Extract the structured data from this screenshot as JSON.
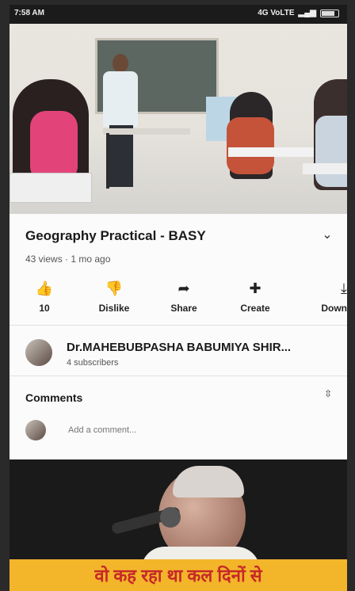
{
  "status_bar": {
    "time": "7:58 AM",
    "network": "4G VoLTE"
  },
  "video": {
    "title": "Geography Practical - BASY",
    "meta": "43 views · 1 mo ago",
    "actions": [
      {
        "icon": "thumbs-up-icon",
        "label": "10"
      },
      {
        "icon": "thumbs-down-icon",
        "label": "Dislike"
      },
      {
        "icon": "share-icon",
        "label": "Share"
      },
      {
        "icon": "create-icon",
        "label": "Create"
      },
      {
        "icon": "download-icon",
        "label": "Down"
      }
    ]
  },
  "channel": {
    "name": "Dr.MAHEBUBPASHA BABUMIYA SHIR...",
    "subscribers": "4 subscribers"
  },
  "comments": {
    "title": "Comments",
    "placeholder": "Add a comment..."
  },
  "next_video": {
    "banner_text": "वो कह रहा था कल दिनों से"
  },
  "colors": {
    "banner_bg": "#f3b52a",
    "banner_text": "#c62828"
  }
}
